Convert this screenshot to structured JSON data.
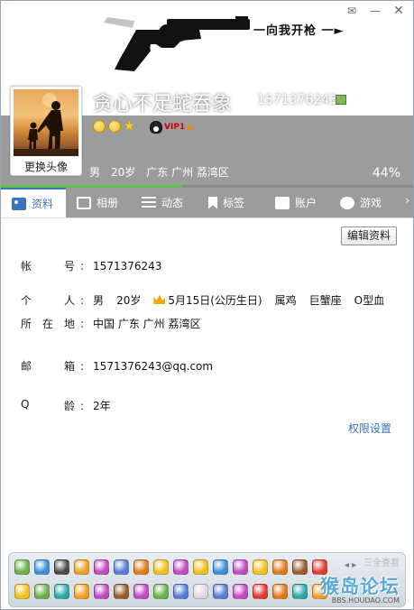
{
  "window": {
    "banner_text": "一向我开枪 一►",
    "controls": [
      "skin-icon",
      "minimize-icon",
      "close-icon"
    ]
  },
  "profile": {
    "change_avatar": "更换头像",
    "nickname": "贪心不足蛇吞象",
    "qq_number": "1571376243",
    "vip_badge": "VIP1",
    "gender": "男",
    "age": "20岁",
    "location": "广东 广州 荔湾区",
    "completion": "44%",
    "completion_fraction": 0.44
  },
  "tabs": [
    {
      "label": "资料",
      "icon": "id-card-icon",
      "active": true
    },
    {
      "label": "相册",
      "icon": "photo-icon",
      "active": false
    },
    {
      "label": "动态",
      "icon": "list-icon",
      "active": false
    },
    {
      "label": "标签",
      "icon": "bookmark-icon",
      "active": false
    },
    {
      "label": "账户",
      "icon": "wallet-icon",
      "active": false
    },
    {
      "label": "游戏",
      "icon": "game-icon",
      "active": false
    }
  ],
  "content": {
    "edit_button": "编辑资料",
    "fields": {
      "account": {
        "label": [
          "帐",
          "号"
        ],
        "value": "1571376243"
      },
      "personal": {
        "label": [
          "个",
          "人"
        ],
        "gender": "男",
        "age": "20岁",
        "birthday": "5月15日(公历生日)",
        "zodiac": "属鸡",
        "constellation": "巨蟹座",
        "blood": "O型血"
      },
      "location": {
        "label": [
          "所",
          "在",
          "地"
        ],
        "value": "中国 广东 广州 荔湾区"
      },
      "email": {
        "label": [
          "邮",
          "箱"
        ],
        "value": "1571376243@qq.com"
      },
      "qage": {
        "label": [
          "Q",
          "龄"
        ],
        "value": "2年"
      }
    },
    "permission_link": "权限设置"
  },
  "tray": {
    "row1_icons": [
      "qq-penguin-icon",
      "lips-icon",
      "pet-icon",
      "music-icon",
      "paw-icon",
      "heart-icon",
      "shield-icon",
      "phone-icon",
      "diamond-icon",
      "diamond-icon",
      "diamond-icon",
      "book-icon",
      "leaf-icon",
      "diamond-icon",
      "diamond-icon",
      "star-icon"
    ],
    "row2_icons": [
      "star-icon",
      "space-icon",
      "game-icon",
      "music-icon",
      "pet-icon",
      "mail-icon",
      "video-icon",
      "red-diamond-icon",
      "yellow-diamond-icon",
      "orange-icon",
      "mail-icon",
      "mail-icon",
      "weather-icon",
      "palette-icon",
      "game-icon",
      "green-icon",
      "music-icon",
      "globe-icon"
    ],
    "watermark": "猴岛论坛",
    "watermark_sub": "BBS.HOUDAO.COM",
    "tray_label": "三全查看"
  },
  "colors": {
    "accent": "#3b74b8",
    "header_gray": "#9c9c9c",
    "progress": "#5ec04a"
  }
}
